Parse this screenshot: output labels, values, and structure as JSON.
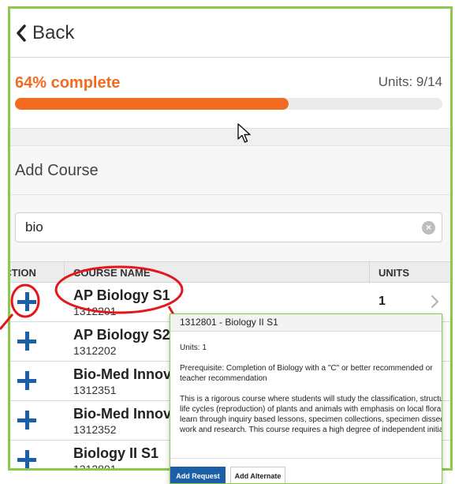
{
  "header": {
    "back_label": "Back"
  },
  "progress": {
    "percent_label": "64% complete",
    "percent": 64,
    "units_label": "Units: 9/14"
  },
  "add_course": {
    "title": "Add Course",
    "search_value": "bio",
    "clear_symbol": "×"
  },
  "table": {
    "headers": {
      "action": "ACTION",
      "name": "COURSE NAME",
      "units": "UNITS"
    },
    "rows": [
      {
        "name": "AP Biology S1",
        "number": "1312201",
        "units": "1"
      },
      {
        "name": "AP Biology S2",
        "number": "1312202",
        "units": ""
      },
      {
        "name": "Bio-Med Innov",
        "number": "1312351",
        "units": ""
      },
      {
        "name": "Bio-Med Innov",
        "number": "1312352",
        "units": ""
      },
      {
        "name": "Biology II S1",
        "number": "1312801",
        "units": ""
      }
    ]
  },
  "popup": {
    "title": "1312801 - Biology II S1",
    "units": "Units: 1",
    "prerequisite": "Prerequisite: Completion of Biology with a \"C\" or better recommended or teacher recommendation",
    "description_lines": [
      "This is a rigorous course where students will study the classification, structure",
      "life cycles (reproduction) of plants and animals with emphasis on local flora an",
      "learn through inquiry based lessons, specimen collections, specimen dissectio",
      "work and research. This course requires a high degree of independent initiative"
    ],
    "add_request_label": "Add Request",
    "add_alternate_label": "Add Alternate"
  },
  "icons": {
    "back": "chevron-left-icon",
    "add": "plus-icon",
    "clear": "clear-circle-icon",
    "row_detail": "chevron-right-icon",
    "cursor": "mouse-pointer-icon"
  },
  "colors": {
    "accent_orange": "#f26b21",
    "plus_blue": "#1a5fa8",
    "frame_green": "#8cc84b",
    "annotation_red": "#e3161b"
  }
}
